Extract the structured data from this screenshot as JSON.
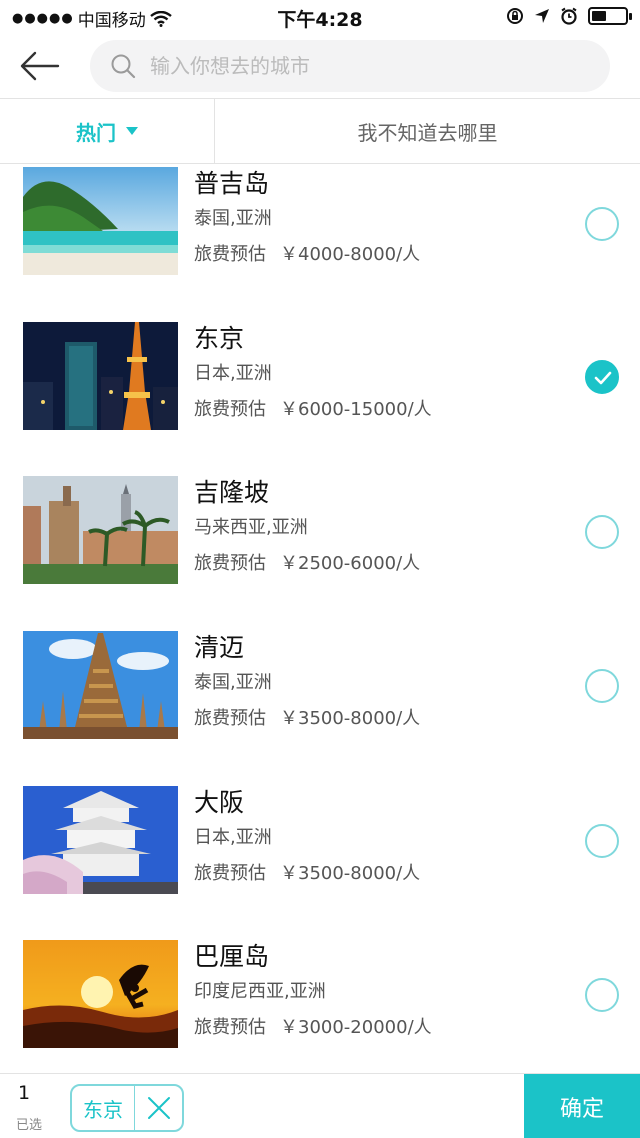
{
  "status_bar": {
    "signal_dots": "●●●●●",
    "carrier": "中国移动",
    "time": "下午4:28",
    "icons": [
      "wifi-icon",
      "rotation-lock-icon",
      "location-arrow-icon",
      "alarm-icon",
      "battery-icon"
    ]
  },
  "search": {
    "placeholder": "输入你想去的城市"
  },
  "tabs": {
    "hot_label": "热门",
    "unknown_label": "我不知道去哪里"
  },
  "destinations": [
    {
      "name": "普吉岛",
      "region": "泰国,亚洲",
      "price_label": "旅费预估",
      "price": "￥4000-8000/人",
      "selected": false
    },
    {
      "name": "东京",
      "region": "日本,亚洲",
      "price_label": "旅费预估",
      "price": "￥6000-15000/人",
      "selected": true
    },
    {
      "name": "吉隆坡",
      "region": "马来西亚,亚洲",
      "price_label": "旅费预估",
      "price": "￥2500-6000/人",
      "selected": false
    },
    {
      "name": "清迈",
      "region": "泰国,亚洲",
      "price_label": "旅费预估",
      "price": "￥3500-8000/人",
      "selected": false
    },
    {
      "name": "大阪",
      "region": "日本,亚洲",
      "price_label": "旅费预估",
      "price": "￥3500-8000/人",
      "selected": false
    },
    {
      "name": "巴厘岛",
      "region": "印度尼西亚,亚洲",
      "price_label": "旅费预估",
      "price": "￥3000-20000/人",
      "selected": false
    }
  ],
  "bottom_bar": {
    "selected_count": "1",
    "selected_label": "已选",
    "chip_label": "东京",
    "confirm_label": "确定"
  },
  "colors": {
    "accent": "#1bc3c8",
    "accent_light": "#7fd8dc"
  }
}
